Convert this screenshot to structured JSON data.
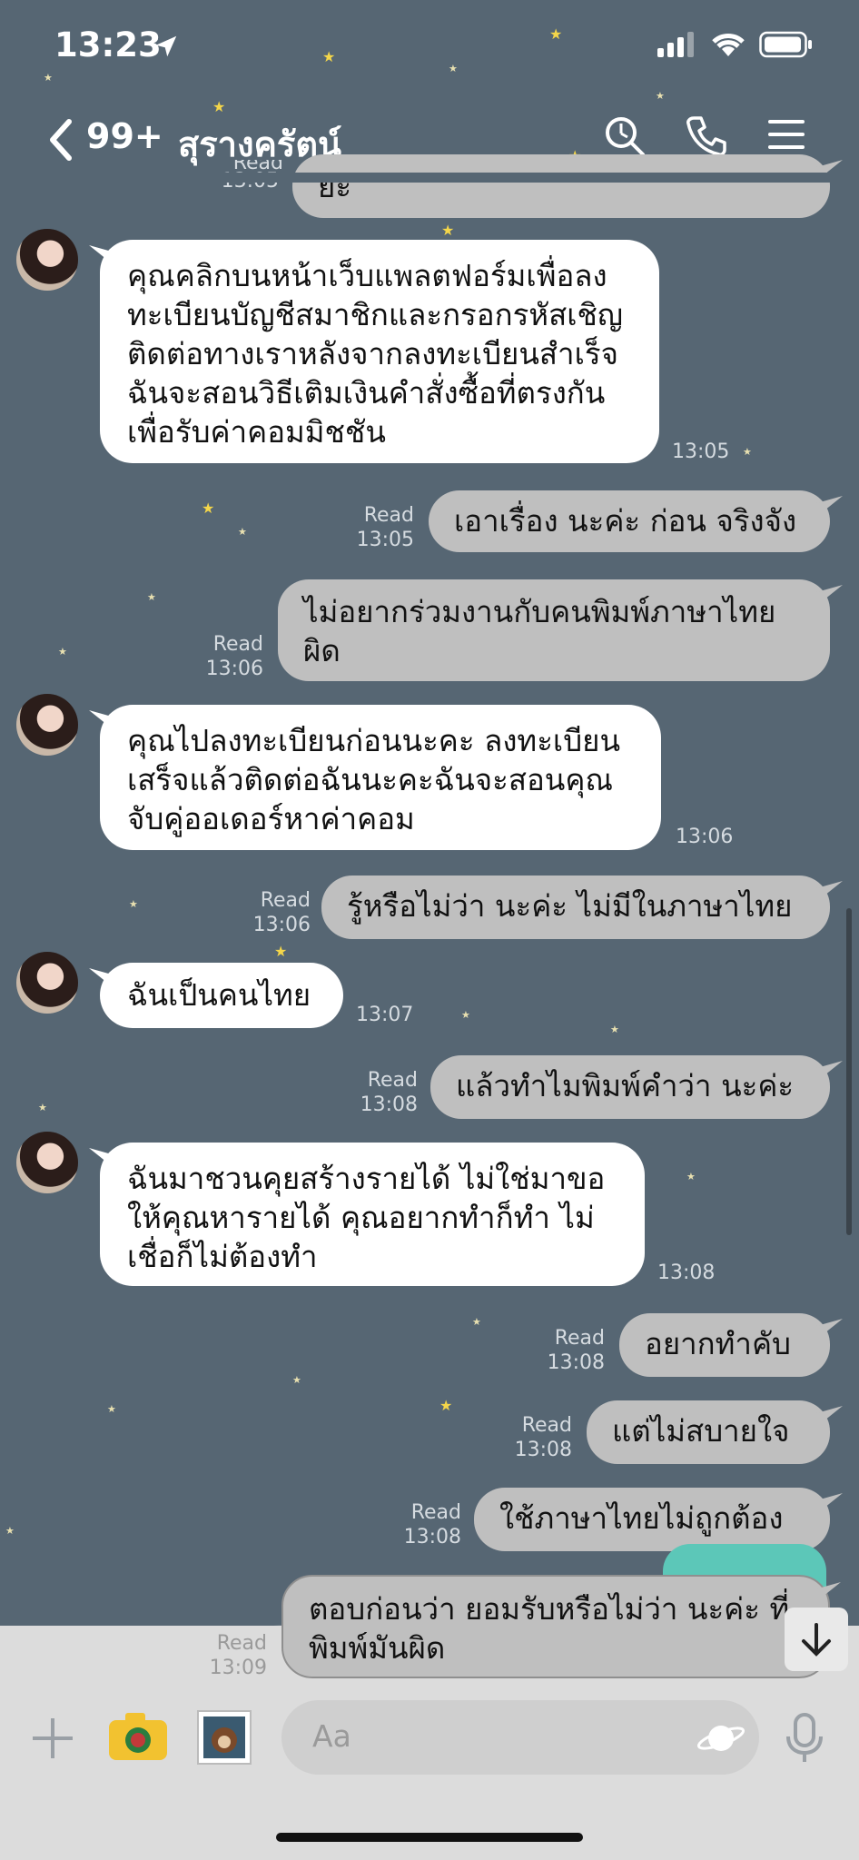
{
  "status_bar": {
    "time": "13:23"
  },
  "header": {
    "unread_count": "99+",
    "contact_name": "สุรางครัตน์"
  },
  "messages": [
    {
      "side": "out",
      "text": "ยะ",
      "status": "Read",
      "time": "13:05"
    },
    {
      "side": "in",
      "text": "คุณคลิกบนหน้าเว็บแพลตฟอร์มเพื่อลงทะเบียนบัญชีสมาชิกและกรอกรหัสเชิญ ติดต่อทางเราหลังจากลงทะเบียนสำเร็จ ฉันจะสอนวิธีเติมเงินคำสั่งซื้อที่ตรงกันเพื่อรับค่าคอมมิชชัน",
      "time": "13:05"
    },
    {
      "side": "out",
      "text": "เอาเรื่อง นะค่ะ ก่อน จริงจัง",
      "status": "Read",
      "time": "13:05"
    },
    {
      "side": "out",
      "text": "ไม่อยากร่วมงานกับคนพิมพ์ภาษาไทยผิด",
      "status": "Read",
      "time": "13:06"
    },
    {
      "side": "in",
      "text": "คุณไปลงทะเบียนก่อนนะคะ ลงทะเบียนเสร็จแล้วติดต่อฉันนะคะฉันจะสอนคุณจับคู่ออเดอร์หาค่าคอม",
      "time": "13:06"
    },
    {
      "side": "out",
      "text": "รู้หรือไม่ว่า นะค่ะ ไม่มีในภาษาไทย",
      "status": "Read",
      "time": "13:06"
    },
    {
      "side": "in",
      "text": "ฉันเป็นคนไทย",
      "time": "13:07"
    },
    {
      "side": "out",
      "text": "แล้วทำไมพิมพ์คำว่า นะค่ะ",
      "status": "Read",
      "time": "13:08"
    },
    {
      "side": "in",
      "text": "ฉันมาชวนคุยสร้างรายได้ ไม่ใช่มาขอให้คุณหารายได้ คุณอยากทำก็ทำ ไม่เชื่อก็ไม่ต้องทำ",
      "time": "13:08"
    },
    {
      "side": "out",
      "text": "อยากทำคับ",
      "status": "Read",
      "time": "13:08"
    },
    {
      "side": "out",
      "text": "แต่ไม่สบายใจ",
      "status": "Read",
      "time": "13:08"
    },
    {
      "side": "out",
      "text": "ใช้ภาษาไทยไม่ถูกต้อง",
      "status": "Read",
      "time": "13:08"
    },
    {
      "side": "out",
      "text": "ตอบก่อนว่า ยอมรับหรือไม่ว่า นะค่ะ ที่พิมพ์มันผิด",
      "status": "Read",
      "time": "13:09"
    }
  ],
  "composer": {
    "placeholder": "Aa"
  },
  "colors": {
    "background": "#566673",
    "outgoing_bubble": "#bfbfbf",
    "incoming_bubble": "#ffffff",
    "star": "#f4d64a"
  },
  "icons": [
    "location-arrow-icon",
    "signal-icon",
    "wifi-icon",
    "battery-icon",
    "back-chevron-icon",
    "search-icon",
    "phone-icon",
    "menu-icon",
    "plus-icon",
    "camera-icon",
    "photo-icon",
    "emoji-icon",
    "mic-icon",
    "scroll-down-icon"
  ]
}
